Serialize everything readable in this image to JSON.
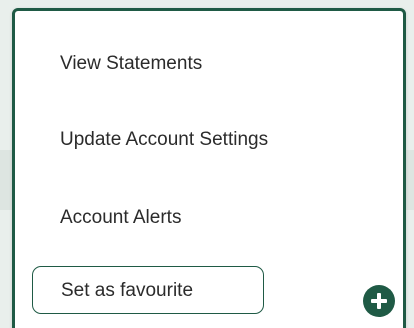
{
  "menu": {
    "items": [
      {
        "label": "View Statements"
      },
      {
        "label": "Update Account Settings"
      },
      {
        "label": "Account Alerts"
      }
    ],
    "favourite": {
      "label": "Set as favourite",
      "add_icon": "plus-circle-icon"
    }
  },
  "colors": {
    "accent": "#1f5a45",
    "panel_background": "#ffffff",
    "page_background": "#e9efec",
    "text": "#2b2b2b"
  }
}
